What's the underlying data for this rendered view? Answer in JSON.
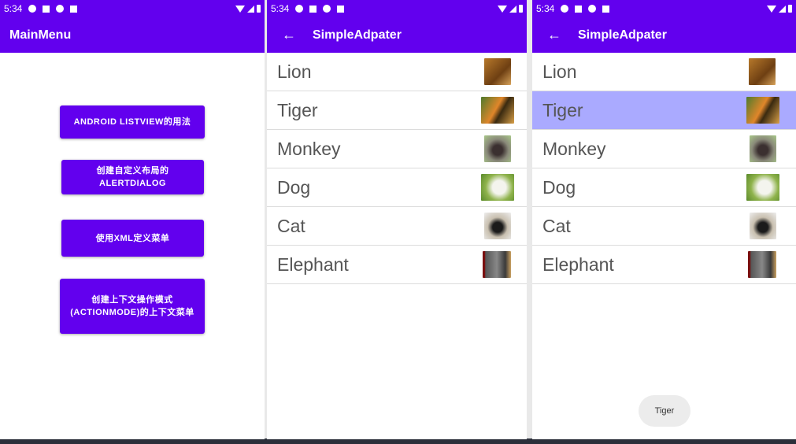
{
  "screens": [
    {
      "status_time": "5:34",
      "title": "MainMenu",
      "buttons": [
        "ANDROID LISTVIEW的用法",
        "创建自定义布局的ALERTDIALOG",
        "使用XML定义菜单",
        "创建上下文操作模式(ACTIONMODE)的上下文菜单"
      ]
    },
    {
      "status_time": "5:34",
      "title": "SimpleAdpater",
      "items": [
        "Lion",
        "Tiger",
        "Monkey",
        "Dog",
        "Cat",
        "Elephant"
      ]
    },
    {
      "status_time": "5:34",
      "title": "SimpleAdpater",
      "items": [
        "Lion",
        "Tiger",
        "Monkey",
        "Dog",
        "Cat",
        "Elephant"
      ],
      "selected_item": "Tiger",
      "toast": "Tiger"
    }
  ],
  "colors": {
    "primary": "#6200ee",
    "selected_row": "#aaaaff",
    "list_text": "#555555"
  },
  "icons": {
    "back": "arrow-left-icon",
    "status": [
      "shield-icon",
      "notification-icon",
      "wifi-icon",
      "sd-card-icon",
      "signal-icon",
      "battery-icon"
    ]
  }
}
